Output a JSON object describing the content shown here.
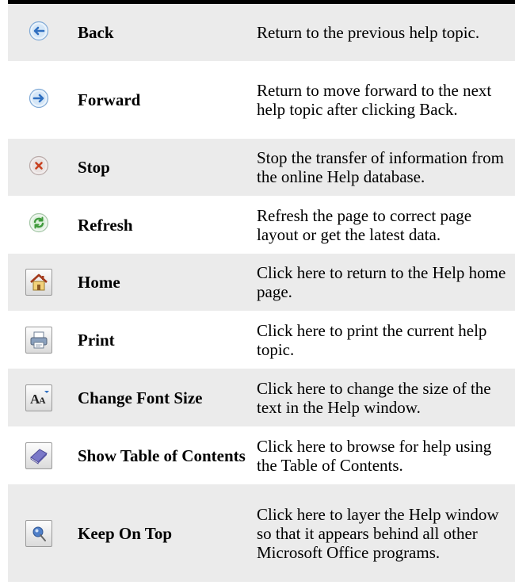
{
  "rows": [
    {
      "icon": "back-arrow-icon",
      "name": "Back",
      "desc": "Return to the previous help topic."
    },
    {
      "icon": "forward-arrow-icon",
      "name": "Forward",
      "desc": "Return to move forward to the next help topic after clicking Back."
    },
    {
      "icon": "stop-icon",
      "name": "Stop",
      "desc": "Stop the transfer of information from the online Help database."
    },
    {
      "icon": "refresh-icon",
      "name": "Refresh",
      "desc": "Refresh the page to correct page layout or get the latest data."
    },
    {
      "icon": "home-icon",
      "name": "Home",
      "desc": "Click here to return to the Help home page."
    },
    {
      "icon": "print-icon",
      "name": "Print",
      "desc": "Click here to print the current help topic."
    },
    {
      "icon": "change-font-size-icon",
      "name": "Change Font Size",
      "desc": "Click here to change the size of the text in the Help window."
    },
    {
      "icon": "table-of-contents-book-icon",
      "name": "Show Table of Contents",
      "desc": "Click here to browse for help using the Table of Contents."
    },
    {
      "icon": "keep-on-top-pushpin-icon",
      "name": "Keep On Top",
      "desc": "Click here to layer the Help window so that it appears behind all other Microsoft Office programs."
    }
  ]
}
